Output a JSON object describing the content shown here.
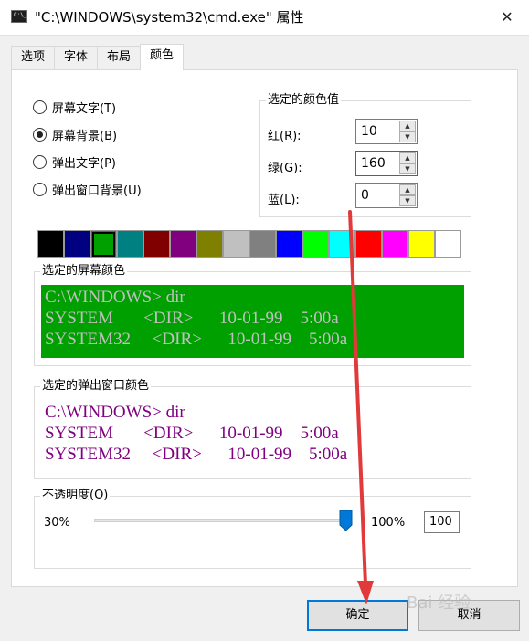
{
  "window": {
    "title": "\"C:\\WINDOWS\\system32\\cmd.exe\" 属性",
    "icon_text": "C:\\_",
    "close_glyph": "✕"
  },
  "tabs": [
    {
      "label": "选项",
      "active": false
    },
    {
      "label": "字体",
      "active": false
    },
    {
      "label": "布局",
      "active": false
    },
    {
      "label": "颜色",
      "active": true
    }
  ],
  "color_target": {
    "options": [
      {
        "label": "屏幕文字(T)",
        "checked": false
      },
      {
        "label": "屏幕背景(B)",
        "checked": true
      },
      {
        "label": "弹出文字(P)",
        "checked": false
      },
      {
        "label": "弹出窗口背景(U)",
        "checked": false
      }
    ]
  },
  "selected_color": {
    "title": "选定的颜色值",
    "red_label": "红(R):",
    "red_value": "10",
    "green_label": "绿(G):",
    "green_value": "160",
    "blue_label": "蓝(L):",
    "blue_value": "0",
    "spin_up": "▲",
    "spin_down": "▼"
  },
  "palette": {
    "colors": [
      "#000000",
      "#000080",
      "#00a000",
      "#008080",
      "#800000",
      "#800080",
      "#808000",
      "#c0c0c0",
      "#808080",
      "#0000ff",
      "#00ff00",
      "#00ffff",
      "#ff0000",
      "#ff00ff",
      "#ffff00",
      "#ffffff"
    ],
    "selected_index": 2
  },
  "screen_preview": {
    "title": "选定的屏幕颜色",
    "lines": [
      "C:\\WINDOWS> dir",
      "SYSTEM       <DIR>      10-01-99    5:00a",
      "SYSTEM32     <DIR>      10-01-99    5:00a"
    ],
    "background": "#00a000",
    "text_color": "#c0c0c0"
  },
  "popup_preview": {
    "title": "选定的弹出窗口颜色",
    "lines": [
      "C:\\WINDOWS> dir",
      "SYSTEM       <DIR>      10-01-99    5:00a",
      "SYSTEM32     <DIR>      10-01-99    5:00a"
    ],
    "background": "#ffffff",
    "text_color": "#800080"
  },
  "opacity": {
    "title": "不透明度(O)",
    "min_label": "30%",
    "max_label": "100%",
    "value": "100",
    "slider_fraction": 1.0
  },
  "buttons": {
    "ok": "确定",
    "cancel": "取消"
  },
  "annotation": {
    "arrow_color": "#e03a3a"
  },
  "watermark": "Bai 经验"
}
